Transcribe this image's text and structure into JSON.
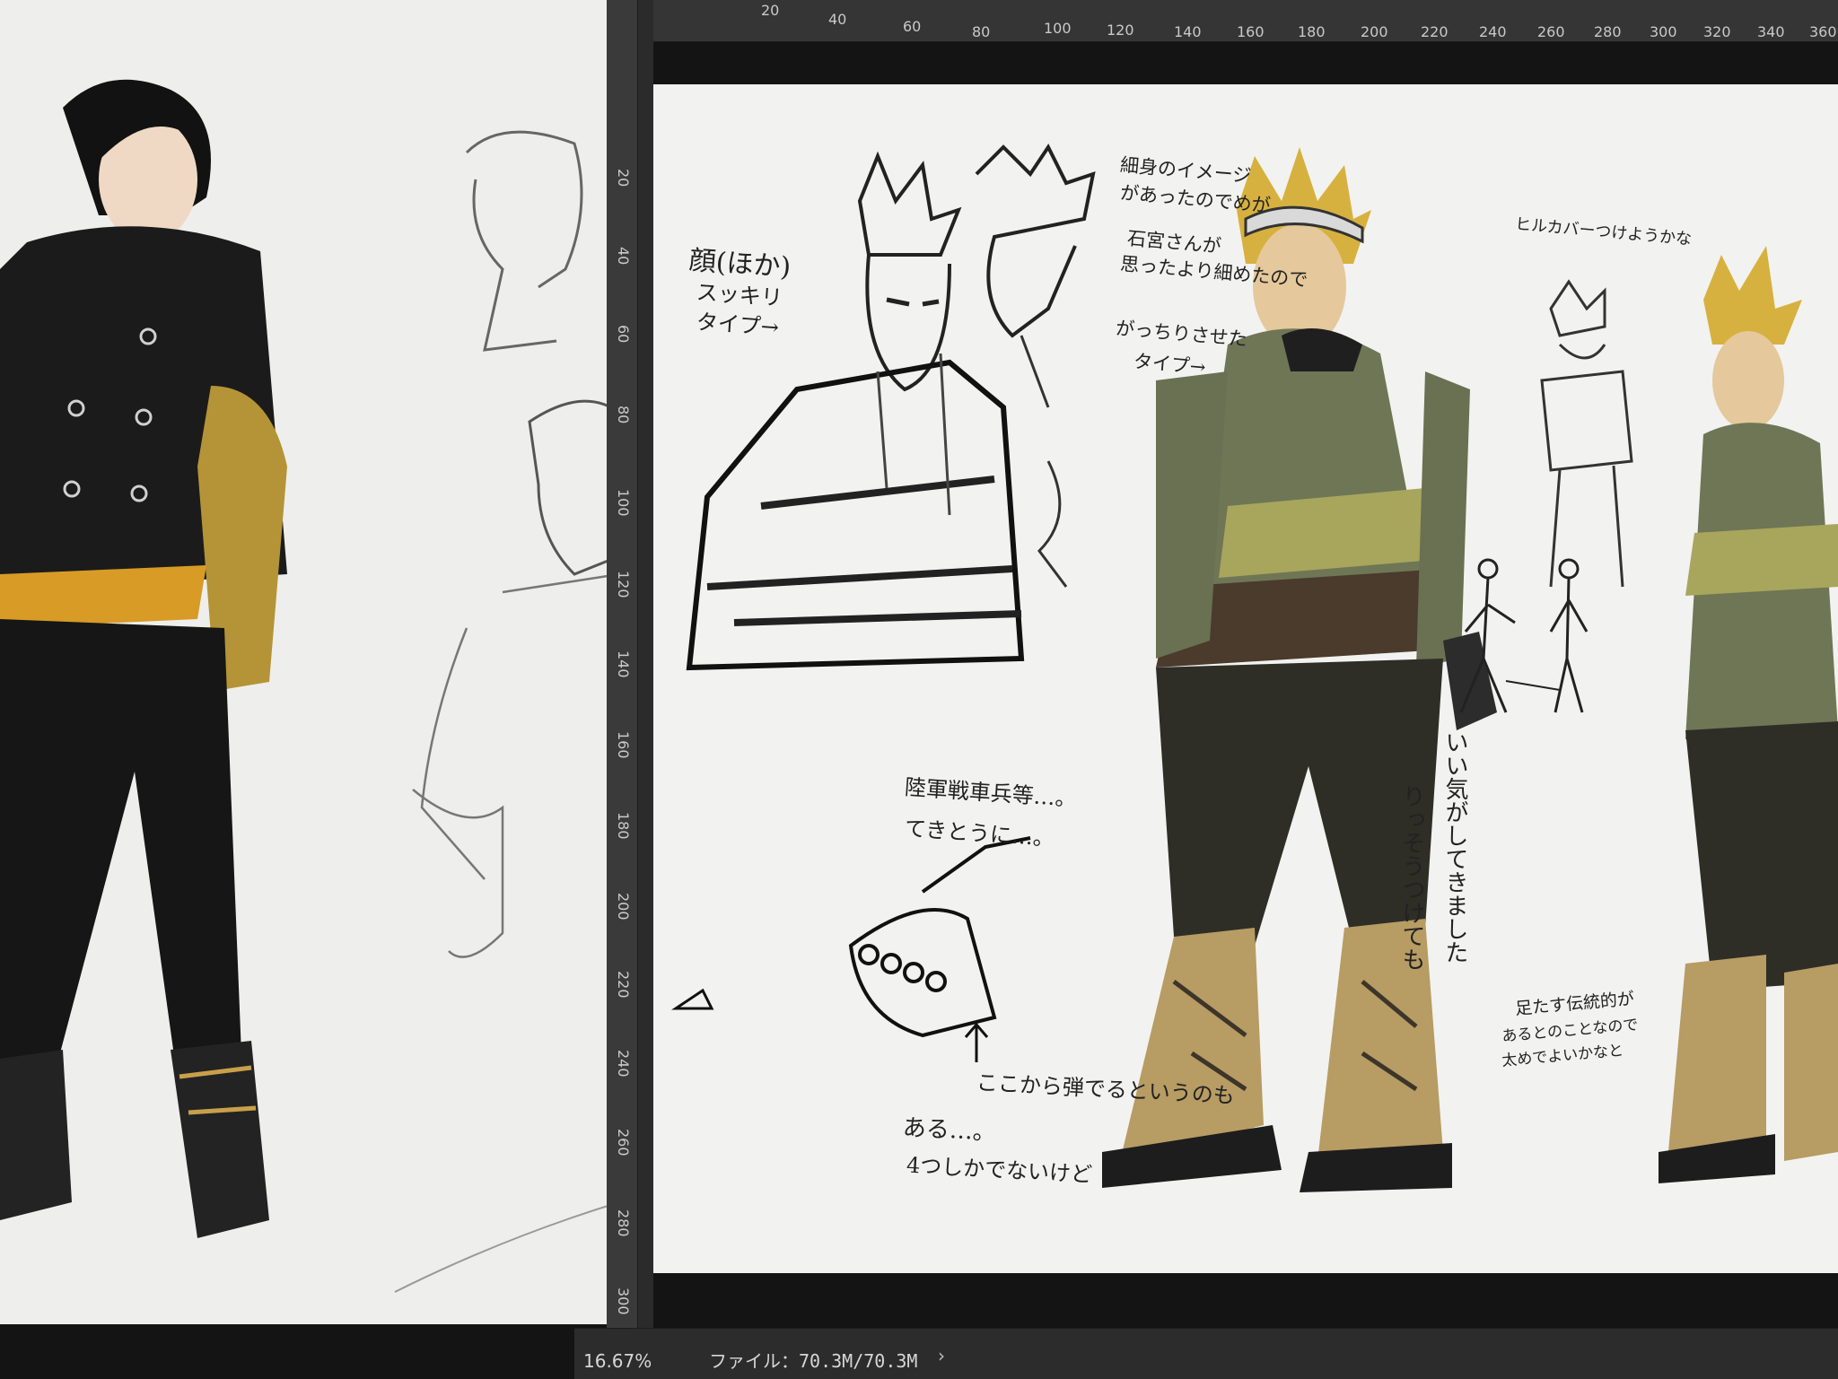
{
  "left_ruler": {
    "numbers": [
      "20",
      "40",
      "60",
      "80",
      "100",
      "120",
      "140",
      "160",
      "180",
      "200",
      "220",
      "240",
      "260",
      "280",
      "300"
    ]
  },
  "top_ruler": {
    "numbers": [
      "20",
      "40",
      "60",
      "80",
      "100",
      "120",
      "140",
      "160",
      "180",
      "200",
      "220",
      "240",
      "260",
      "280",
      "300",
      "320",
      "340",
      "360"
    ]
  },
  "status_bar": {
    "zoom": "16.67%",
    "file_info": "ファイル：70.3M/70.3M",
    "arrow": "›"
  },
  "annotations": {
    "face_label": "顔(ほか)",
    "face_line2": "スッキリ",
    "face_line3": "タイプ→",
    "slim_1": "細身のイメージ",
    "slim_2": "があったのでめが",
    "slim_3": "石宮さんが",
    "slim_4": "思ったより細めたので",
    "solid_1": "がっちりさせた",
    "solid_2": "タイプ→",
    "hip_cover": "ヒルカバーつけようかな",
    "army_1": "陸軍戦車兵等…。",
    "army_2": "てきとうに…。",
    "gun_1": "ここから弾でるというのも",
    "gun_2": "ある…。",
    "gun_3": "4つしかでないけど",
    "vertical_1": "いい気がしてきました",
    "vertical_2": "りっそうつけても",
    "feet_1": "足たす伝統的が",
    "feet_2": "あるとのことなので",
    "feet_3": "太めでよいかなと"
  }
}
